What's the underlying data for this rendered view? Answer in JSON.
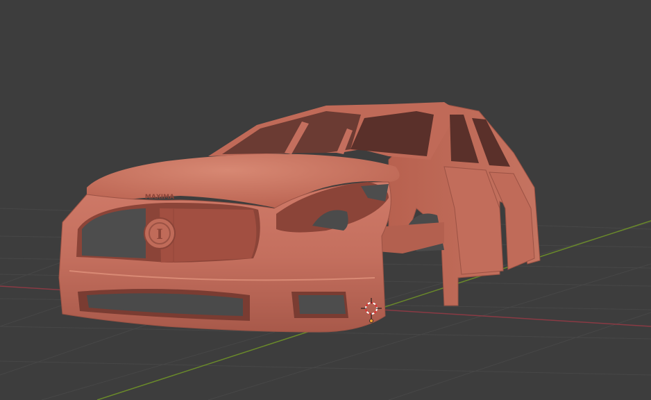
{
  "viewport": {
    "background": "#3d3d3d",
    "grid_color": "#4a4a4a",
    "x_axis_color": "#8a3a44",
    "y_axis_color": "#6a8a2a"
  },
  "model": {
    "body_color": "#c46f5e",
    "shadow_color": "#7e3f35",
    "badge_text": "MAXIMA",
    "emblem_text": "I"
  },
  "cursor": {
    "ring_color": "#e03030",
    "name": "3d-cursor-icon"
  },
  "origin": {
    "color": "#f0a030",
    "name": "object-origin-icon"
  }
}
